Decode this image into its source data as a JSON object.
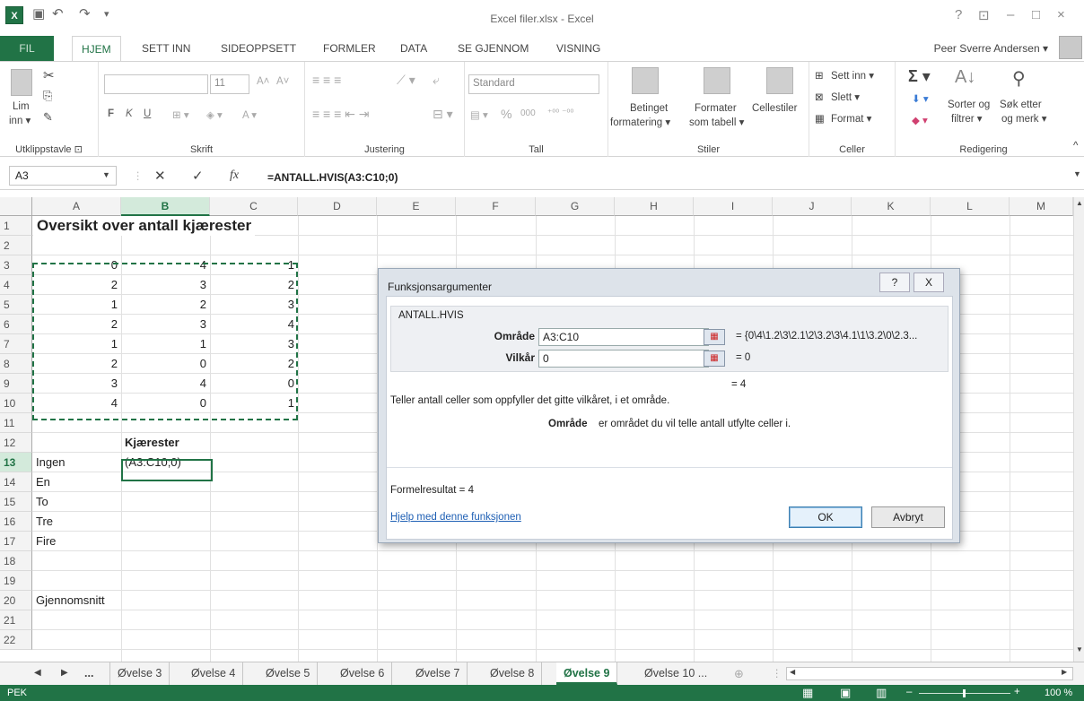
{
  "window": {
    "title": "Excel filer.xlsx - Excel",
    "help": "?",
    "minimize": "–",
    "restore": "□",
    "close": "×"
  },
  "ribbon_tabs": [
    "FIL",
    "HJEM",
    "SETT INN",
    "SIDEOPPSETT",
    "FORMLER",
    "DATA",
    "SE GJENNOM",
    "VISNING"
  ],
  "user": "Peer Sverre Andersen ▾",
  "ribbon": {
    "clipboard": {
      "paste": "Lim",
      "paste2": "inn ▾",
      "label": "Utklippstavle ⊡"
    },
    "font": {
      "size": "11",
      "bold": "F",
      "italic": "K",
      "underline": "U",
      "grow": "A˄",
      "shrink": "A˅",
      "label": "Skrift"
    },
    "alignment": {
      "label": "Justering"
    },
    "number": {
      "format": "Standard",
      "percent": "%",
      "thousands": "000",
      "label": "Tall"
    },
    "styles": {
      "cond": "Betinget",
      "cond2": "formatering ▾",
      "table": "Formater",
      "table2": "som tabell ▾",
      "cell": "Cellestiler",
      "label": "Stiler"
    },
    "cells": {
      "insert": "Sett inn ▾",
      "delete": "Slett ▾",
      "format": "Format ▾",
      "label": "Celler"
    },
    "editing": {
      "sum": "Σ ▾",
      "sort": "Sorter og",
      "sort2": "filtrer ▾",
      "find": "Søk etter",
      "find2": "og merk ▾",
      "label": "Redigering"
    }
  },
  "formula_bar": {
    "name_box": "A3",
    "fx": "fx",
    "formula": "=ANTALL.HVIS(A3:C10;0)"
  },
  "columns": [
    "A",
    "B",
    "C",
    "D",
    "E",
    "F",
    "G",
    "H",
    "I",
    "J",
    "K",
    "L",
    "M"
  ],
  "rows": [
    "1",
    "2",
    "3",
    "4",
    "5",
    "6",
    "7",
    "8",
    "9",
    "10",
    "11",
    "12",
    "13",
    "14",
    "15",
    "16",
    "17",
    "18",
    "19",
    "20",
    "21",
    "22"
  ],
  "cells": {
    "title": "Oversikt over antall kjærester",
    "data": [
      [
        0,
        4,
        1
      ],
      [
        2,
        3,
        2
      ],
      [
        1,
        2,
        3
      ],
      [
        2,
        3,
        4
      ],
      [
        1,
        1,
        3
      ],
      [
        2,
        0,
        2
      ],
      [
        3,
        4,
        0
      ],
      [
        4,
        0,
        1
      ]
    ],
    "b12": "Kjærester",
    "b13": "(A3:C10;0)",
    "labels": [
      "Ingen",
      "En",
      "To",
      "Tre",
      "Fire"
    ],
    "a20": "Gjennomsnitt"
  },
  "sheet_tabs": [
    "...",
    "Øvelse 3",
    "Øvelse 4",
    "Øvelse 5",
    "Øvelse 6",
    "Øvelse 7",
    "Øvelse 8",
    "Øvelse 9",
    "Øvelse 10 ..."
  ],
  "active_sheet": "Øvelse 9",
  "status": {
    "mode": "PEK",
    "zoom": "100 %"
  },
  "dialog": {
    "title": "Funksjonsargumenter",
    "help_btn": "?",
    "close_btn": "X",
    "function": "ANTALL.HVIS",
    "arg1_label": "Område",
    "arg1_value": "A3:C10",
    "arg1_result": "=  {0\\4\\1.2\\3\\2.1\\2\\3.2\\3\\4.1\\1\\3.2\\0\\2.3...",
    "arg2_label": "Vilkår",
    "arg2_value": "0",
    "arg2_result": "=  0",
    "total_result": "=  4",
    "description": "Teller antall celler som oppfyller det gitte vilkåret, i et område.",
    "arg_help_name": "Område",
    "arg_help_text": "er området du vil telle antall utfylte celler i.",
    "formula_result": "Formelresultat =   4",
    "help_link": "Hjelp med denne funksjonen",
    "ok": "OK",
    "cancel": "Avbryt"
  }
}
